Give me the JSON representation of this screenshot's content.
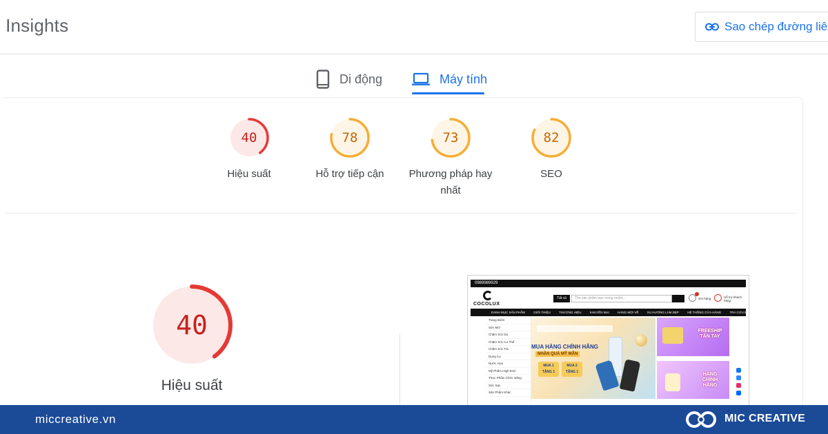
{
  "header": {
    "title": "d Insights",
    "copy_link_label": "Sao chép đường liê"
  },
  "device_tabs": [
    {
      "label": "Di động",
      "icon": "smartphone-icon",
      "selected": false
    },
    {
      "label": "Máy tính",
      "icon": "laptop-icon",
      "selected": true
    }
  ],
  "scores": [
    {
      "value": "40",
      "label": "Hiệu suất",
      "color": "#e53935",
      "fill": 0.4
    },
    {
      "value": "78",
      "label": "Hỗ trợ tiếp cận",
      "color": "#f6ad34",
      "fill": 0.78
    },
    {
      "value": "73",
      "label": "Phương pháp hay nhất",
      "color": "#f6ad34",
      "fill": 0.73
    },
    {
      "value": "82",
      "label": "SEO",
      "color": "#f6ad34",
      "fill": 0.82
    }
  ],
  "main_score": {
    "value": "40",
    "label": "Hiệu suất",
    "color": "#e53935",
    "fill": 0.4
  },
  "thumbnail": {
    "phone": "0989989929",
    "logo": "COCOLUX",
    "search_category": "Tất cả",
    "search_placeholder": "Tìm sản phẩm bạn mong muốn...",
    "nav_items": [
      "DANH MỤC SẢN PHẨM",
      "GIỚI THIỆU",
      "THƯƠNG HIỆU",
      "KHUYẾN MẠI",
      "HÀNG MỚI VỀ",
      "XU HƯỚNG LÀM ĐẸP",
      "HỆ THỐNG CỬA HÀNG",
      "TRA CỨU ĐƠN HÀNG"
    ],
    "side_items": [
      "Trang Điểm",
      "Sức Mỏi",
      "Chăm Sóc Da",
      "Chăm Sóc Cơ Thể",
      "Chăm Sóc Tóc",
      "Dụng Cụ",
      "Nước Hoa",
      "Mỹ Phẩm High-End",
      "Thực Phẩm Chức Năng",
      "Sức Sạc",
      "Sản Phẩm Khác"
    ],
    "banner_title": "MUA HÀNG CHÍNH HÃNG",
    "banner_subtitle": "NHẬN QUÀ MỸ MÃN",
    "offer_1": "MUA 1 TẶNG 1",
    "offer_2": "MUA 2 TẶNG 1",
    "promo_1": "FREESHIP TẬN TAY",
    "promo_2": "HÀNG CHÍNH HÃNG",
    "header_links": [
      "Giỏ hàng",
      "Hỗ trợ khách hàng"
    ]
  },
  "footer": {
    "site": "miccreative.vn",
    "brand": "MIC CREATIVE",
    "background": "#1b4a97"
  },
  "colors": {
    "accent": "#1a73e8",
    "fail": "#e53935",
    "average": "#f6ad34"
  }
}
